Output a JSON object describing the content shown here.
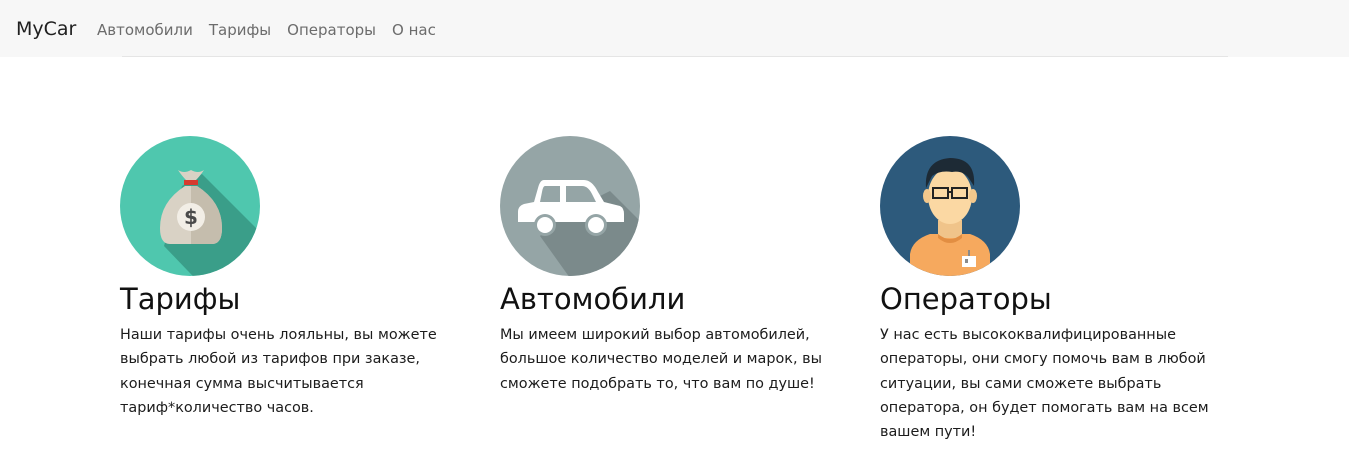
{
  "navbar": {
    "brand": "MyCar",
    "links": [
      "Автомобили",
      "Тарифы",
      "Операторы",
      "О нас"
    ]
  },
  "features": [
    {
      "title": "Тарифы",
      "icon": "money-bag-icon",
      "text": "Наши тарифы очень лояльны, вы можете выбрать любой из тарифов при заказе, конечная сумма высчитывается тариф*количество часов."
    },
    {
      "title": "Автомобили",
      "icon": "car-icon",
      "text": "Мы имеем широкий выбор автомобилей, большое количество моделей и марок, вы сможете подобрать то, что вам по душе!"
    },
    {
      "title": "Операторы",
      "icon": "operator-avatar-icon",
      "text": "У нас есть высококвалифицированные операторы, они смогу помочь вам в любой ситуации, вы сами сможете выбрать оператора, он будет помогать вам на всем вашем пути!"
    }
  ],
  "colors": {
    "navbar_bg": "#f7f7f7",
    "money_circle": "#4fc7ae",
    "car_circle": "#95a5a6",
    "operator_circle": "#2d5a7c",
    "operator_shirt": "#f6a95e"
  }
}
